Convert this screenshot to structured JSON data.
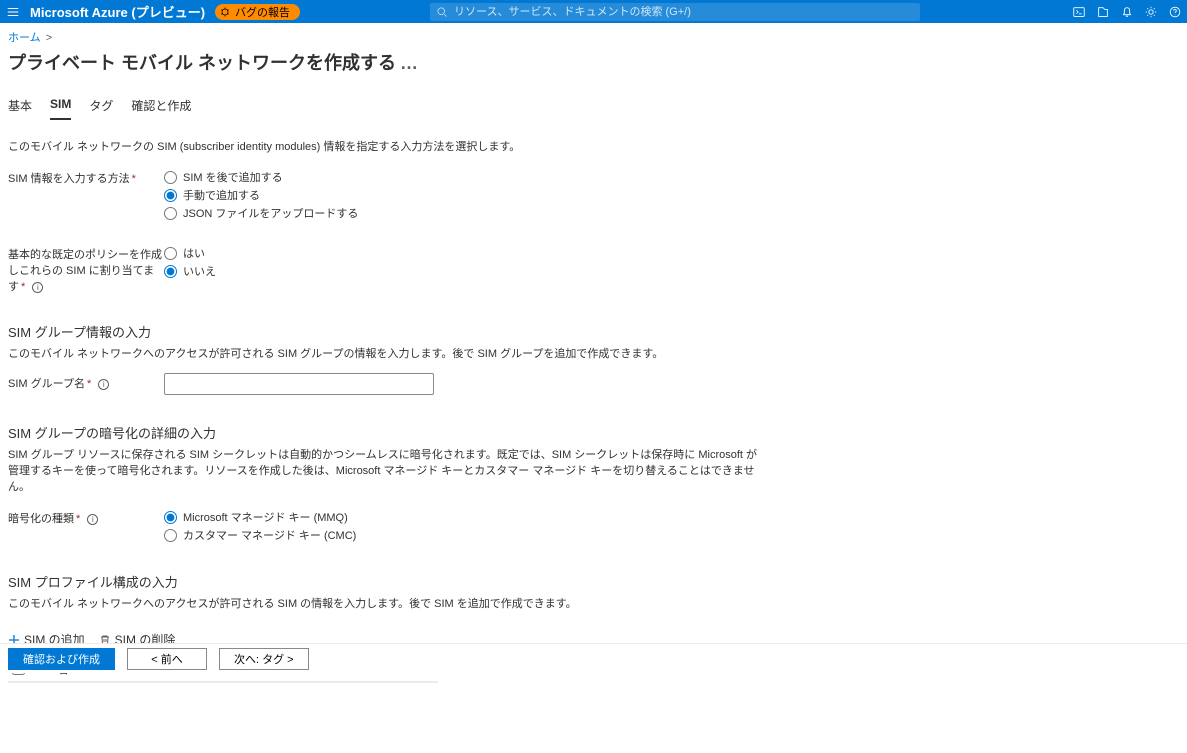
{
  "header": {
    "brand": "Microsoft Azure (プレビュー)",
    "bug_label": "バグの報告",
    "search_placeholder": "リソース、サービス、ドキュメントの検索 (G+/)"
  },
  "breadcrumb": {
    "home": "ホーム"
  },
  "page": {
    "title": "プライベート モバイル ネットワークを作成する"
  },
  "tabs": {
    "basic": "基本",
    "sim": "SIM",
    "tags": "タグ",
    "review": "確認と作成"
  },
  "sim_intro": "このモバイル ネットワークの SIM (subscriber identity modules) 情報を指定する入力方法を選択します。",
  "sim_method": {
    "label": "SIM 情報を入力する方法",
    "opt_later": "SIM を後で追加する",
    "opt_manual": "手動で追加する",
    "opt_json": "JSON ファイルをアップロードする"
  },
  "policy": {
    "label": "基本的な既定のポリシーを作成しこれらの SIM に割り当てます",
    "yes": "はい",
    "no": "いいえ"
  },
  "group": {
    "title": "SIM グループ情報の入力",
    "desc": "このモバイル ネットワークへのアクセスが許可される SIM グループの情報を入力します。後で SIM グループを追加で作成できます。",
    "name_label": "SIM グループ名"
  },
  "encryption": {
    "title": "SIM グループの暗号化の詳細の入力",
    "desc": "SIM グループ リソースに保存される SIM シークレットは自動的かつシームレスに暗号化されます。既定では、SIM シークレットは保存時に Microsoft が管理するキーを使って暗号化されます。リソースを作成した後は、Microsoft マネージド キーとカスタマー マネージド キーを切り替えることはできません。",
    "type_label": "暗号化の種類",
    "mmq": "Microsoft マネージド キー (MMQ)",
    "cmc": "カスタマー マネージド キー (CMC)"
  },
  "profile": {
    "title": "SIM プロファイル構成の入力",
    "desc": "このモバイル ネットワークへのアクセスが許可される SIM の情報を入力します。後で SIM を追加で作成できます。",
    "add": "SIM の追加",
    "delete": "SIM の削除",
    "col_name": "SIM 名"
  },
  "footer": {
    "review": "確認および作成",
    "prev": "< 前へ",
    "next": "次へ: タグ >"
  }
}
